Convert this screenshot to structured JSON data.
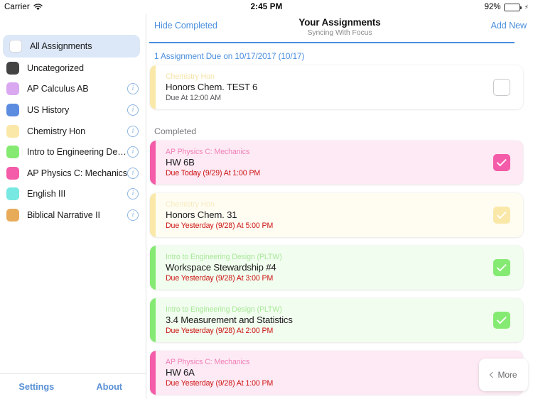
{
  "status_bar": {
    "carrier": "Carrier",
    "wifi_icon": "wifi-icon",
    "time": "2:45 PM",
    "battery_percent": "92%",
    "battery_level": 92,
    "battery_charging": true
  },
  "sidebar": {
    "items": [
      {
        "label": "All Assignments",
        "color": "#ffffff",
        "selected": true,
        "has_info": false,
        "swatch_outline": true
      },
      {
        "label": "Uncategorized",
        "color": "#434343",
        "selected": false,
        "has_info": false,
        "swatch_outline": false
      },
      {
        "label": "AP Calculus AB",
        "color": "#d9a8f0",
        "selected": false,
        "has_info": true,
        "swatch_outline": false
      },
      {
        "label": "US History",
        "color": "#5c8ce0",
        "selected": false,
        "has_info": true,
        "swatch_outline": false
      },
      {
        "label": "Chemistry Hon",
        "color": "#fae8a8",
        "selected": false,
        "has_info": true,
        "swatch_outline": false
      },
      {
        "label": "Intro to Engineering Design…",
        "color": "#85ea72",
        "selected": false,
        "has_info": true,
        "swatch_outline": false
      },
      {
        "label": "AP Physics C: Mechanics",
        "color": "#f45ba8",
        "selected": false,
        "has_info": true,
        "swatch_outline": false
      },
      {
        "label": "English III",
        "color": "#78e8e2",
        "selected": false,
        "has_info": true,
        "swatch_outline": false
      },
      {
        "label": "Biblical Narrative II",
        "color": "#e8ab5a",
        "selected": false,
        "has_info": true,
        "swatch_outline": false
      }
    ],
    "footer": {
      "settings_label": "Settings",
      "about_label": "About"
    }
  },
  "header": {
    "hide_completed_label": "Hide Completed",
    "title": "Your Assignments",
    "subtitle": "Syncing With Focus",
    "add_new_label": "Add New",
    "accent_color": "#4a8ede"
  },
  "sections": [
    {
      "heading": "1 Assignment Due on 10/17/2017 (10/17)",
      "heading_style": "blue",
      "cards": [
        {
          "course": "Chemistry Hon",
          "title": "Honors Chem. TEST 6",
          "due": "Due At 12:00 AM",
          "due_style": "normal",
          "accent_color": "#fae8a8",
          "background": "#ffffff",
          "course_color": "#f6e3a6",
          "checked": false,
          "check_color": "#ffffff"
        }
      ]
    },
    {
      "heading": "Completed",
      "heading_style": "grey",
      "cards": [
        {
          "course": "AP Physics C: Mechanics",
          "title": "HW 6B",
          "due": "Due Today (9/29) At 1:00 PM",
          "due_style": "overdue",
          "accent_color": "#f45ba8",
          "background": "#fdeaf4",
          "course_color": "#f07fb8",
          "checked": true,
          "check_color": "#f45ba8"
        },
        {
          "course": "Chemistry Hon",
          "title": "Honors Chem. 31",
          "due": "Due Yesterday (9/28) At 5:00 PM",
          "due_style": "overdue",
          "accent_color": "#fae8a8",
          "background": "#fffdf2",
          "course_color": "#f7eac0",
          "checked": true,
          "check_color": "#fae8a8"
        },
        {
          "course": "Intro to Engineering Design (PLTW)",
          "title": "Workspace Stewardship #4",
          "due": "Due Yesterday (9/28) At 3:00 PM",
          "due_style": "overdue",
          "accent_color": "#85ea72",
          "background": "#f1fdee",
          "course_color": "#a9e89b",
          "checked": true,
          "check_color": "#85ea72"
        },
        {
          "course": "Intro to Engineering Design (PLTW)",
          "title": "3.4 Measurement and Statistics",
          "due": "Due Yesterday (9/28) At 2:00 PM",
          "due_style": "overdue",
          "accent_color": "#85ea72",
          "background": "#f1fdee",
          "course_color": "#a9e89b",
          "checked": true,
          "check_color": "#85ea72"
        },
        {
          "course": "AP Physics C: Mechanics",
          "title": "HW 6A",
          "due": "Due Yesterday (9/28) At 1:00 PM",
          "due_style": "overdue",
          "accent_color": "#f45ba8",
          "background": "#fdeaf4",
          "course_color": "#f07fb8",
          "checked": false,
          "check_color": "#f45ba8"
        }
      ]
    }
  ],
  "more_button": {
    "label": "More",
    "chevron_icon": "chevron-left-icon"
  }
}
